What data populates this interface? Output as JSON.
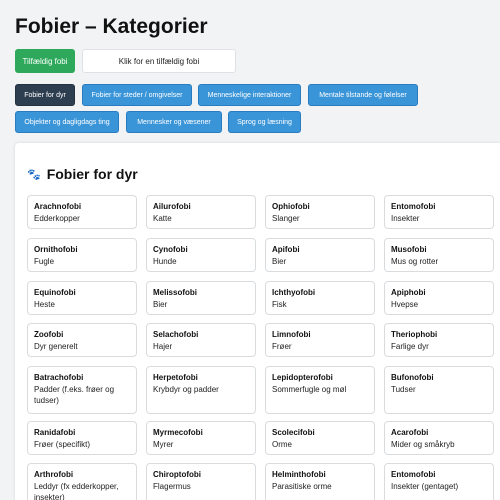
{
  "page_title": "Fobier – Kategorier",
  "random": {
    "button_label": "Tilfældig fobi",
    "output_text": "Klik for en tilfældig fobi"
  },
  "categories": [
    {
      "label": "Fobier for dyr",
      "active": true
    },
    {
      "label": "Fobier for steder / omgivelser",
      "active": false
    },
    {
      "label": "Menneskelige interaktioner",
      "active": false
    },
    {
      "label": "Mentale tilstande og følelser",
      "active": false
    },
    {
      "label": "Objekter og dagligdags ting",
      "active": false
    },
    {
      "label": "Mennesker og væsener",
      "active": false
    },
    {
      "label": "Sprog og læsning",
      "active": false
    }
  ],
  "section": {
    "icon": "paw-icon",
    "title": "Fobier for dyr"
  },
  "phobias": [
    {
      "name": "Arachnofobi",
      "desc": "Edderkopper"
    },
    {
      "name": "Ailurofobi",
      "desc": "Katte"
    },
    {
      "name": "Ophiofobi",
      "desc": "Slanger"
    },
    {
      "name": "Entomofobi",
      "desc": "Insekter"
    },
    {
      "name": "Ornithofobi",
      "desc": "Fugle"
    },
    {
      "name": "Cynofobi",
      "desc": "Hunde"
    },
    {
      "name": "Apifobi",
      "desc": "Bier"
    },
    {
      "name": "Musofobi",
      "desc": "Mus og rotter"
    },
    {
      "name": "Equinofobi",
      "desc": "Heste"
    },
    {
      "name": "Melissofobi",
      "desc": "Bier"
    },
    {
      "name": "Ichthyofobi",
      "desc": "Fisk"
    },
    {
      "name": "Apiphobi",
      "desc": "Hvepse"
    },
    {
      "name": "Zoofobi",
      "desc": "Dyr generelt"
    },
    {
      "name": "Selachofobi",
      "desc": "Hajer"
    },
    {
      "name": "Limnofobi",
      "desc": "Frøer"
    },
    {
      "name": "Theriophobi",
      "desc": "Farlige dyr"
    },
    {
      "name": "Batrachofobi",
      "desc": "Padder (f.eks. frøer og tudser)"
    },
    {
      "name": "Herpetofobi",
      "desc": "Krybdyr og padder"
    },
    {
      "name": "Lepidopterofobi",
      "desc": "Sommerfugle og møl"
    },
    {
      "name": "Bufonofobi",
      "desc": "Tudser"
    },
    {
      "name": "Ranidafobi",
      "desc": "Frøer (specifikt)"
    },
    {
      "name": "Myrmecofobi",
      "desc": "Myrer"
    },
    {
      "name": "Scolecifobi",
      "desc": "Orme"
    },
    {
      "name": "Acarofobi",
      "desc": "Mider og småkryb"
    },
    {
      "name": "Arthrofobi",
      "desc": "Leddyr (fx edderkopper, insekter)"
    },
    {
      "name": "Chiroptofobi",
      "desc": "Flagermus"
    },
    {
      "name": "Helminthofobi",
      "desc": "Parasitiske orme"
    },
    {
      "name": "Entomofobi",
      "desc": "Insekter (gentaget)"
    }
  ]
}
